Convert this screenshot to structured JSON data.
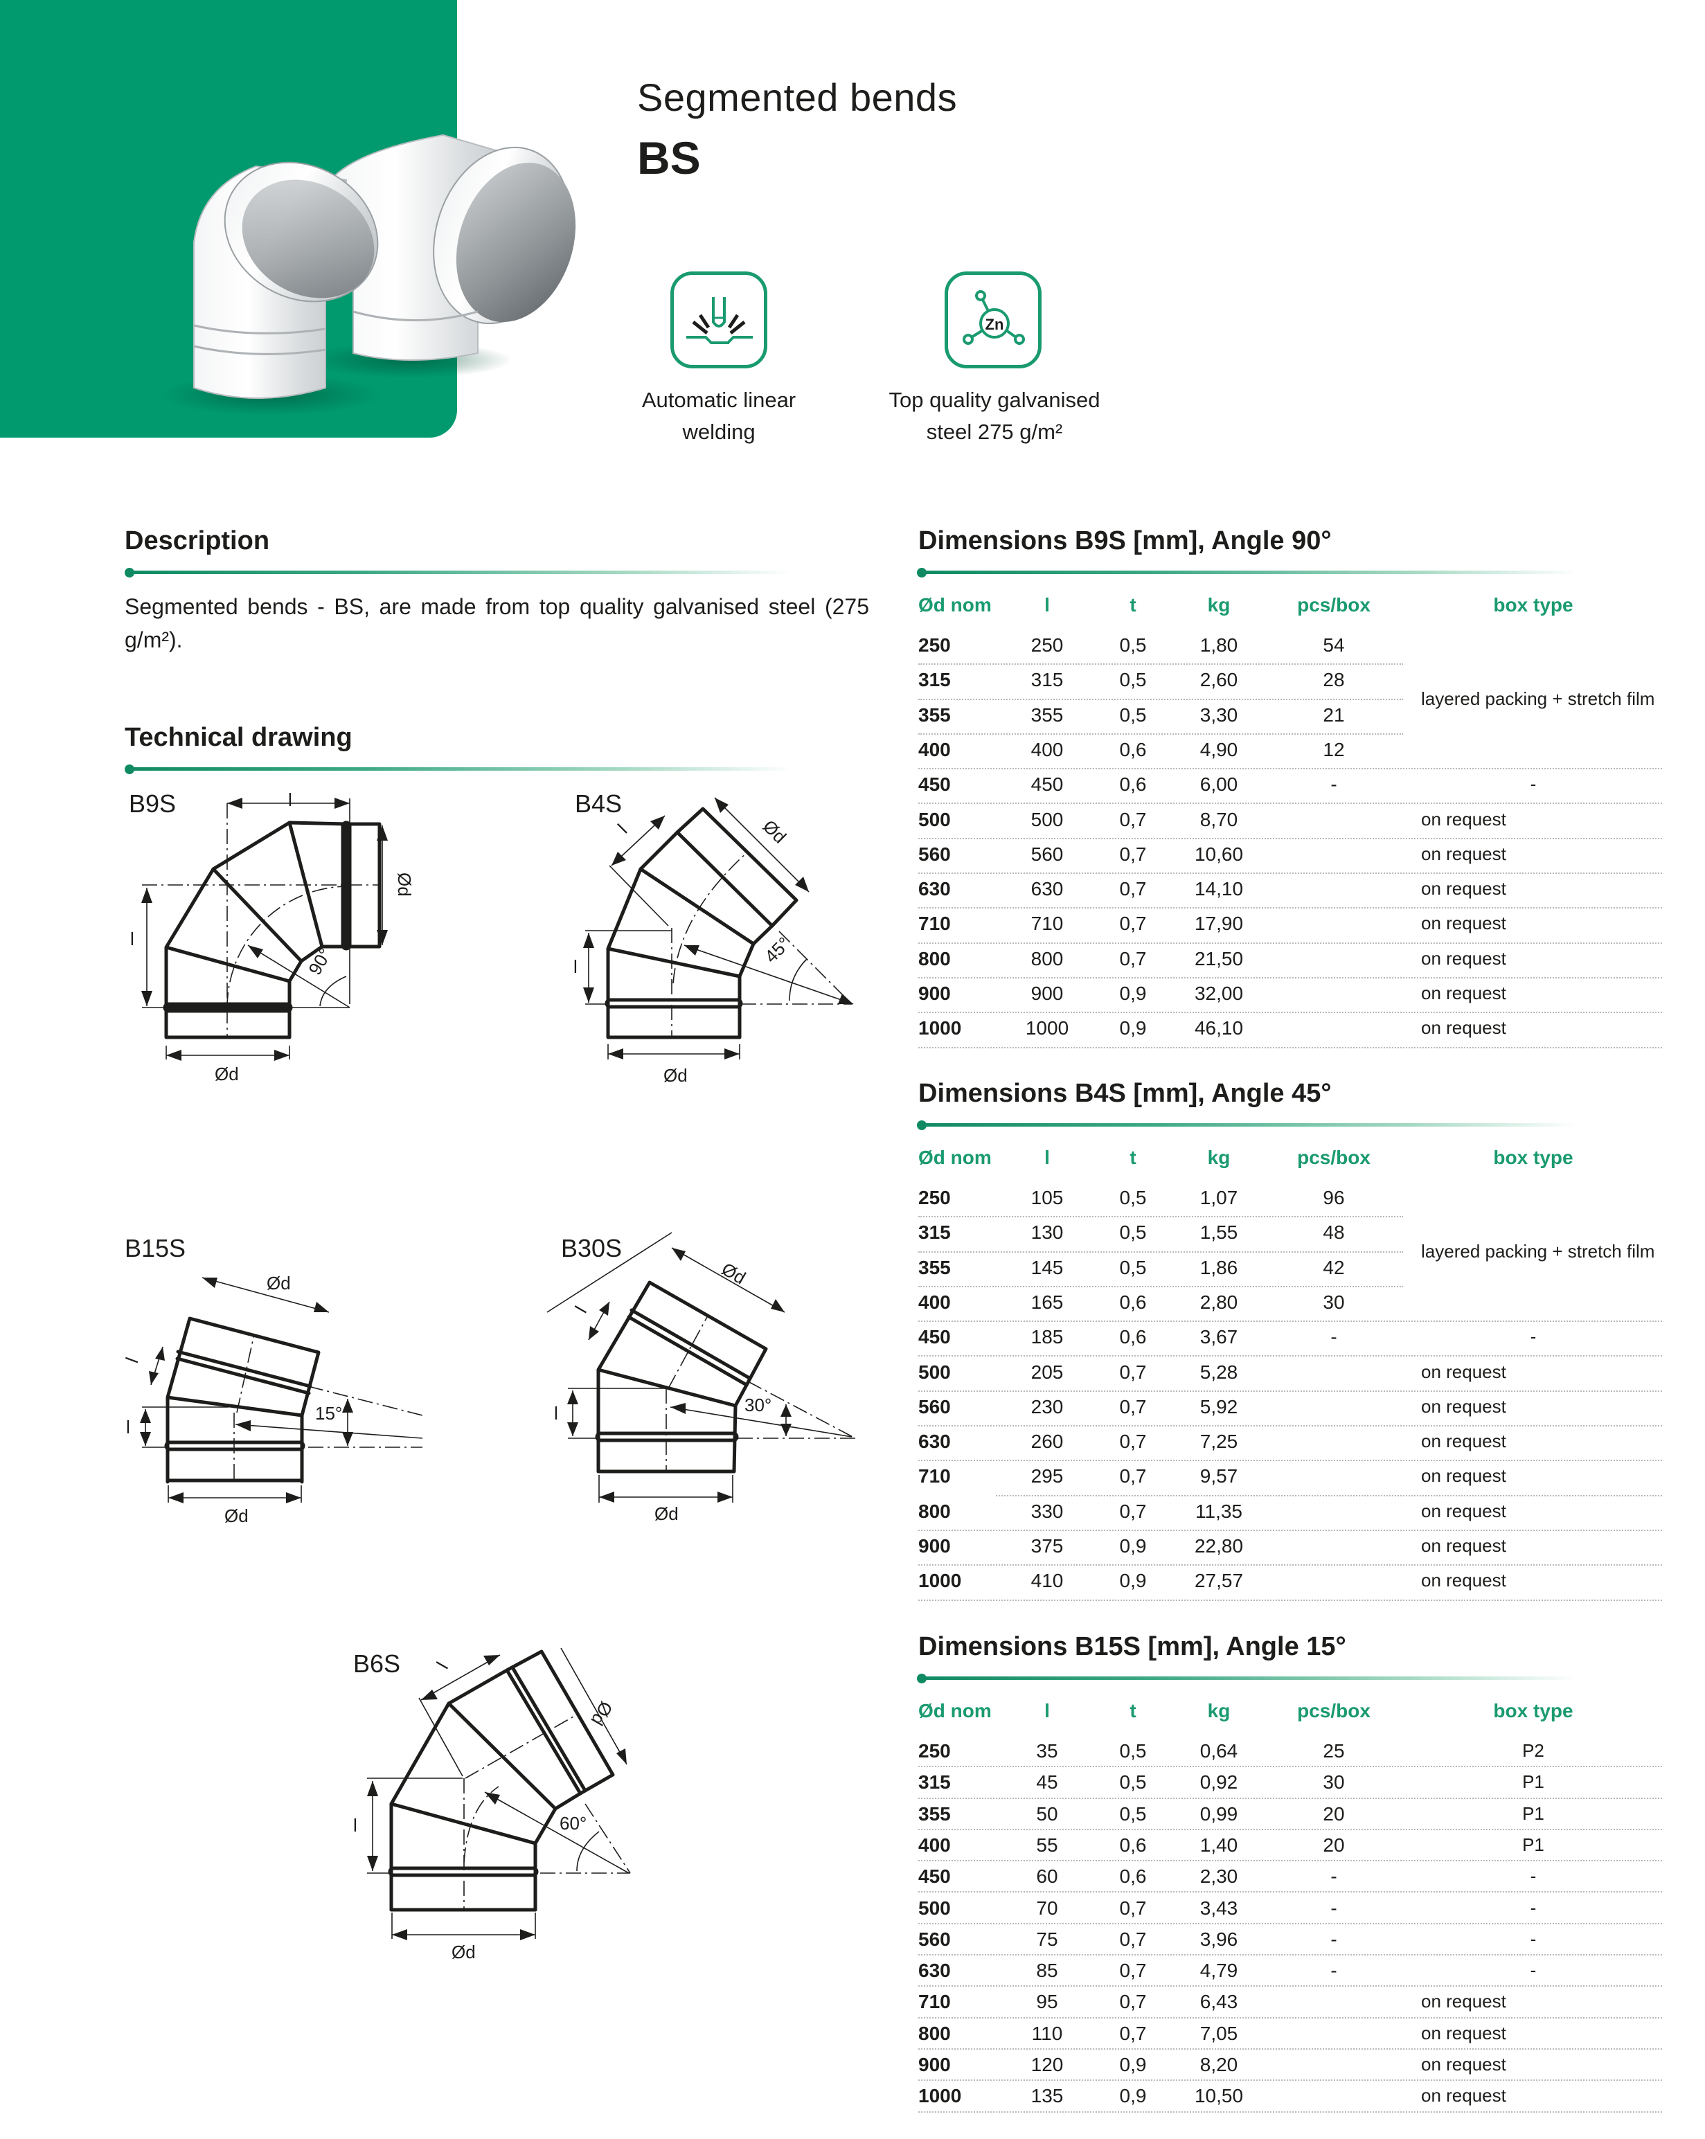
{
  "header": {
    "title": "Segmented bends",
    "code": "BS"
  },
  "features": [
    {
      "icon": "welding-torch-icon",
      "caption_line1": "Automatic linear",
      "caption_line2": "welding"
    },
    {
      "icon": "zinc-molecule-icon",
      "icon_text": "Zn",
      "caption_line1": "Top quality galvanised",
      "caption_line2": "steel 275 g/m²"
    }
  ],
  "description": {
    "heading": "Description",
    "text": "Segmented bends - BS, are made from top quality galvanised steel (275 g/m²)."
  },
  "technical_drawing": {
    "heading": "Technical drawing",
    "drawings": [
      {
        "label": "B9S",
        "angle": "90°",
        "dim_l": "l",
        "dim_d": "Ød"
      },
      {
        "label": "B4S",
        "angle": "45°",
        "dim_l": "l",
        "dim_d": "Ød"
      },
      {
        "label": "B15S",
        "angle": "15°",
        "dim_l": "l",
        "dim_d": "Ød"
      },
      {
        "label": "B30S",
        "angle": "30°",
        "dim_l": "l",
        "dim_d": "Ød"
      },
      {
        "label": "B6S",
        "angle": "60°",
        "dim_l": "l",
        "dim_d": "Ød"
      }
    ]
  },
  "tables": [
    {
      "title": "Dimensions B9S [mm], Angle 90°",
      "columns": [
        "Ød nom",
        "l",
        "t",
        "kg",
        "pcs/box",
        "box type"
      ],
      "merged_box_type": "layered packing + stretch film",
      "rows": [
        [
          "250",
          "250",
          "0,5",
          "1,80",
          "54",
          ""
        ],
        [
          "315",
          "315",
          "0,5",
          "2,60",
          "28",
          ""
        ],
        [
          "355",
          "355",
          "0,5",
          "3,30",
          "21",
          ""
        ],
        [
          "400",
          "400",
          "0,6",
          "4,90",
          "12",
          ""
        ],
        [
          "450",
          "450",
          "0,6",
          "6,00",
          "-",
          "-"
        ],
        [
          "500",
          "500",
          "0,7",
          "8,70",
          "",
          "on request"
        ],
        [
          "560",
          "560",
          "0,7",
          "10,60",
          "",
          "on request"
        ],
        [
          "630",
          "630",
          "0,7",
          "14,10",
          "",
          "on request"
        ],
        [
          "710",
          "710",
          "0,7",
          "17,90",
          "",
          "on request"
        ],
        [
          "800",
          "800",
          "0,7",
          "21,50",
          "",
          "on request"
        ],
        [
          "900",
          "900",
          "0,9",
          "32,00",
          "",
          "on request"
        ],
        [
          "1000",
          "1000",
          "0,9",
          "46,10",
          "",
          "on request"
        ]
      ]
    },
    {
      "title": "Dimensions B4S [mm], Angle 45°",
      "columns": [
        "Ød nom",
        "l",
        "t",
        "kg",
        "pcs/box",
        "box type"
      ],
      "merged_box_type": "layered packing + stretch film",
      "rows": [
        [
          "250",
          "105",
          "0,5",
          "1,07",
          "96",
          ""
        ],
        [
          "315",
          "130",
          "0,5",
          "1,55",
          "48",
          ""
        ],
        [
          "355",
          "145",
          "0,5",
          "1,86",
          "42",
          ""
        ],
        [
          "400",
          "165",
          "0,6",
          "2,80",
          "30",
          ""
        ],
        [
          "450",
          "185",
          "0,6",
          "3,67",
          "-",
          "-"
        ],
        [
          "500",
          "205",
          "0,7",
          "5,28",
          "",
          "on request"
        ],
        [
          "560",
          "230",
          "0,7",
          "5,92",
          "",
          "on request"
        ],
        [
          "630",
          "260",
          "0,7",
          "7,25",
          "",
          "on request"
        ],
        [
          "710",
          "295",
          "0,7",
          "9,57",
          "",
          "on request"
        ],
        [
          "800",
          "330",
          "0,7",
          "11,35",
          "",
          "on request"
        ],
        [
          "900",
          "375",
          "0,9",
          "22,80",
          "",
          "on request"
        ],
        [
          "1000",
          "410",
          "0,9",
          "27,57",
          "",
          "on request"
        ]
      ]
    },
    {
      "title": "Dimensions B15S [mm], Angle 15°",
      "columns": [
        "Ød nom",
        "l",
        "t",
        "kg",
        "pcs/box",
        "box type"
      ],
      "merged_box_type": "",
      "rows": [
        [
          "250",
          "35",
          "0,5",
          "0,64",
          "25",
          "P2"
        ],
        [
          "315",
          "45",
          "0,5",
          "0,92",
          "30",
          "P1"
        ],
        [
          "355",
          "50",
          "0,5",
          "0,99",
          "20",
          "P1"
        ],
        [
          "400",
          "55",
          "0,6",
          "1,40",
          "20",
          "P1"
        ],
        [
          "450",
          "60",
          "0,6",
          "2,30",
          "-",
          "-"
        ],
        [
          "500",
          "70",
          "0,7",
          "3,43",
          "-",
          "-"
        ],
        [
          "560",
          "75",
          "0,7",
          "3,96",
          "-",
          "-"
        ],
        [
          "630",
          "85",
          "0,7",
          "4,79",
          "-",
          "-"
        ],
        [
          "710",
          "95",
          "0,7",
          "6,43",
          "",
          "on request"
        ],
        [
          "800",
          "110",
          "0,7",
          "7,05",
          "",
          "on request"
        ],
        [
          "900",
          "120",
          "0,9",
          "8,20",
          "",
          "on request"
        ],
        [
          "1000",
          "135",
          "0,9",
          "10,50",
          "",
          "on request"
        ]
      ]
    }
  ],
  "colors": {
    "brand_green": "#009a6e",
    "accent_green": "#1a9a70",
    "text": "#1d1d1b"
  }
}
